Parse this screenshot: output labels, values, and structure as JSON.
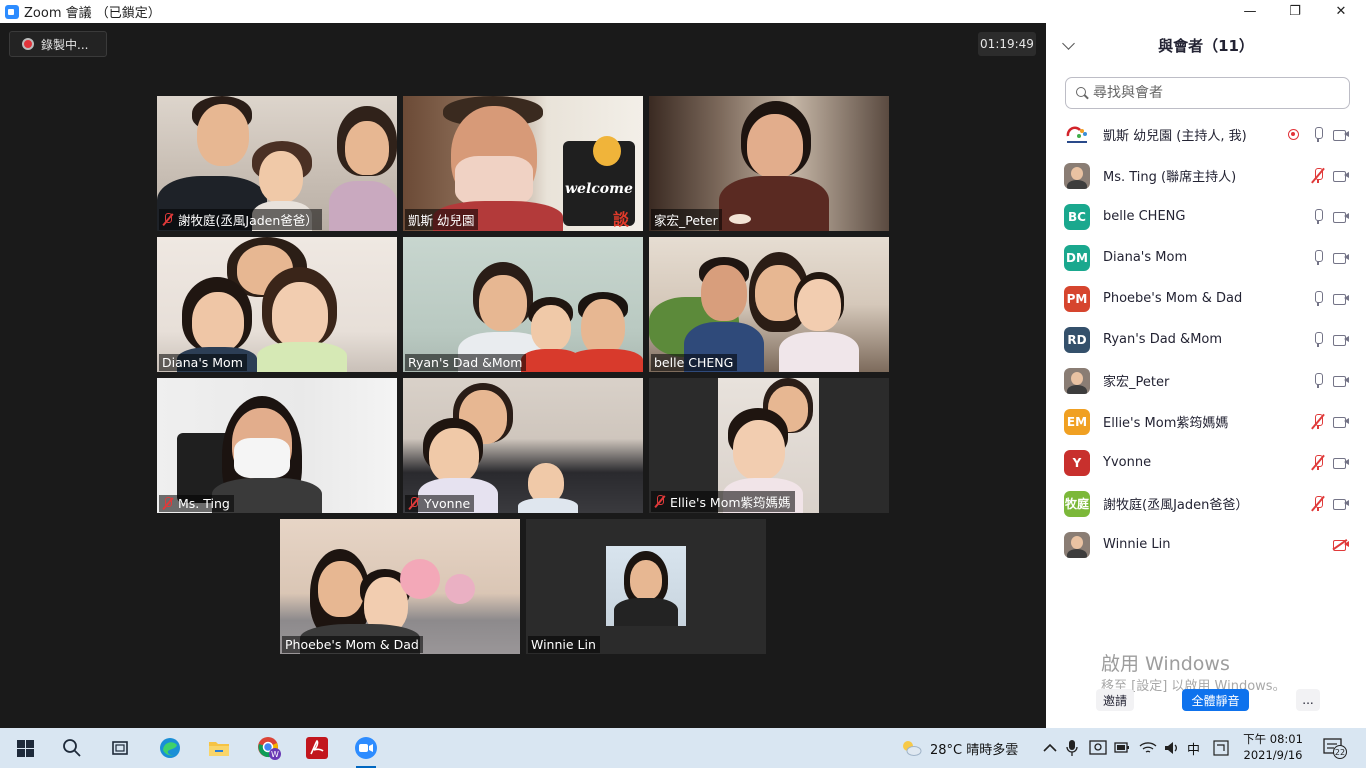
{
  "window": {
    "title": "Zoom 會議 （已鎖定）",
    "minimize_glyph": "—",
    "maximize_glyph": "❐",
    "close_glyph": "✕"
  },
  "meeting": {
    "recording_label": "錄製中...",
    "elapsed": "01:19:49",
    "tiles": [
      {
        "name": "謝牧庭(丞風Jaden爸爸）",
        "muted": true,
        "active": false
      },
      {
        "name": "凱斯 幼兒園",
        "muted": false,
        "active": true
      },
      {
        "name": "家宏_Peter",
        "muted": false,
        "active": false
      },
      {
        "name": "Diana's Mom",
        "muted": false,
        "active": false
      },
      {
        "name": "Ryan's Dad &Mom",
        "muted": false,
        "active": false
      },
      {
        "name": "belle CHENG",
        "muted": false,
        "active": false
      },
      {
        "name": "Ms. Ting",
        "muted": true,
        "active": false
      },
      {
        "name": "Yvonne",
        "muted": true,
        "active": false
      },
      {
        "name": "Ellie's Mom紫筠媽媽",
        "muted": true,
        "active": false
      },
      {
        "name": "Phoebe's Mom & Dad",
        "muted": false,
        "active": false
      },
      {
        "name": "Winnie Lin",
        "muted": false,
        "active": false
      }
    ],
    "tile_decor": {
      "welcome_sign": "welcome",
      "sign_char": "談"
    }
  },
  "participants_panel": {
    "title": "與會者（11）",
    "search_placeholder": "尋找與會者",
    "participants": [
      {
        "name": "凱斯 幼兒園 (主持人, 我)",
        "avatar": "logo",
        "avatar_text": "",
        "color": "#ffffff",
        "recording": true,
        "muted": false,
        "video_off": false
      },
      {
        "name": "Ms. Ting (聯席主持人)",
        "avatar": "photo",
        "avatar_text": "",
        "color": "#8a7d74",
        "recording": false,
        "muted": true,
        "video_off": false
      },
      {
        "name": "belle CHENG",
        "avatar": "initials",
        "avatar_text": "BC",
        "color": "#1aa88e",
        "recording": false,
        "muted": false,
        "video_off": false
      },
      {
        "name": "Diana's Mom",
        "avatar": "initials",
        "avatar_text": "DM",
        "color": "#1aa88e",
        "recording": false,
        "muted": false,
        "video_off": false
      },
      {
        "name": "Phoebe's Mom & Dad",
        "avatar": "initials",
        "avatar_text": "PM",
        "color": "#d6452e",
        "recording": false,
        "muted": false,
        "video_off": false
      },
      {
        "name": "Ryan's Dad &Mom",
        "avatar": "initials",
        "avatar_text": "RD",
        "color": "#34506b",
        "recording": false,
        "muted": false,
        "video_off": false
      },
      {
        "name": "家宏_Peter",
        "avatar": "photo",
        "avatar_text": "",
        "color": "#8a7d74",
        "recording": false,
        "muted": false,
        "video_off": false
      },
      {
        "name": "Ellie's Mom紫筠媽媽",
        "avatar": "initials",
        "avatar_text": "EM",
        "color": "#f0a022",
        "recording": false,
        "muted": true,
        "video_off": false
      },
      {
        "name": "Yvonne",
        "avatar": "initials",
        "avatar_text": "Y",
        "color": "#c8302d",
        "recording": false,
        "muted": true,
        "video_off": false
      },
      {
        "name": "謝牧庭(丞風Jaden爸爸）",
        "avatar": "initials",
        "avatar_text": "牧庭",
        "color": "#7cb83a",
        "recording": false,
        "muted": true,
        "video_off": false
      },
      {
        "name": "Winnie Lin",
        "avatar": "photo",
        "avatar_text": "",
        "color": "#8a7d74",
        "recording": false,
        "muted": false,
        "video_off": true
      }
    ],
    "watermark_title": "啟用 Windows",
    "watermark_sub": "移至 [設定] 以啟用 Windows。",
    "invite_label": "邀請",
    "mute_all_label": "全體靜音",
    "more_label": "..."
  },
  "taskbar": {
    "apps": [
      {
        "icon": "windows-start-icon",
        "active": false
      },
      {
        "icon": "search-icon",
        "active": false
      },
      {
        "icon": "task-view-icon",
        "active": false
      },
      {
        "icon": "edge-icon",
        "active": false
      },
      {
        "icon": "file-explorer-icon",
        "active": false
      },
      {
        "icon": "chrome-icon",
        "active": false
      },
      {
        "icon": "acrobat-icon",
        "active": false
      },
      {
        "icon": "zoom-icon",
        "active": true
      }
    ],
    "weather": "28°C  晴時多雲",
    "ime": "中",
    "time": "下午 08:01",
    "date": "2021/9/16",
    "notifications": "22"
  }
}
